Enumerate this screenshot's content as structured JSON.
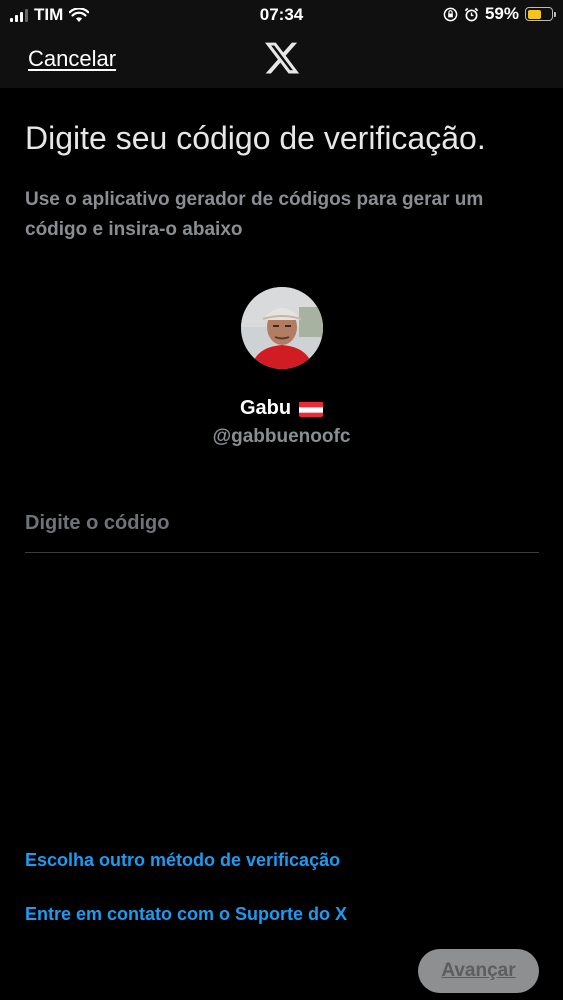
{
  "status_bar": {
    "carrier": "TIM",
    "time": "07:34",
    "battery_percent": "59%",
    "battery_level": 0.59,
    "icons": [
      "signal-icon",
      "wifi-icon",
      "orientation-lock-icon",
      "alarm-icon",
      "battery-icon"
    ]
  },
  "header": {
    "cancel_label": "Cancelar",
    "logo": "x-logo"
  },
  "main": {
    "title": "Digite seu código de verificação.",
    "subtitle": "Use o aplicativo gerador de códigos para gerar um código e insira-o abaixo"
  },
  "user": {
    "name": "Gabu",
    "flag": "🇦🇹",
    "handle": "@gabbuenoofc"
  },
  "code_input": {
    "placeholder": "Digite o código",
    "value": ""
  },
  "links": {
    "alternate_method": "Escolha outro método de verificação",
    "support": "Entre em contato com o Suporte do X"
  },
  "footer": {
    "next_label": "Avançar"
  },
  "colors": {
    "background": "#000000",
    "link": "#1d9bf0",
    "muted_text": "#8a8d91",
    "button_disabled": "#8e8f91"
  }
}
